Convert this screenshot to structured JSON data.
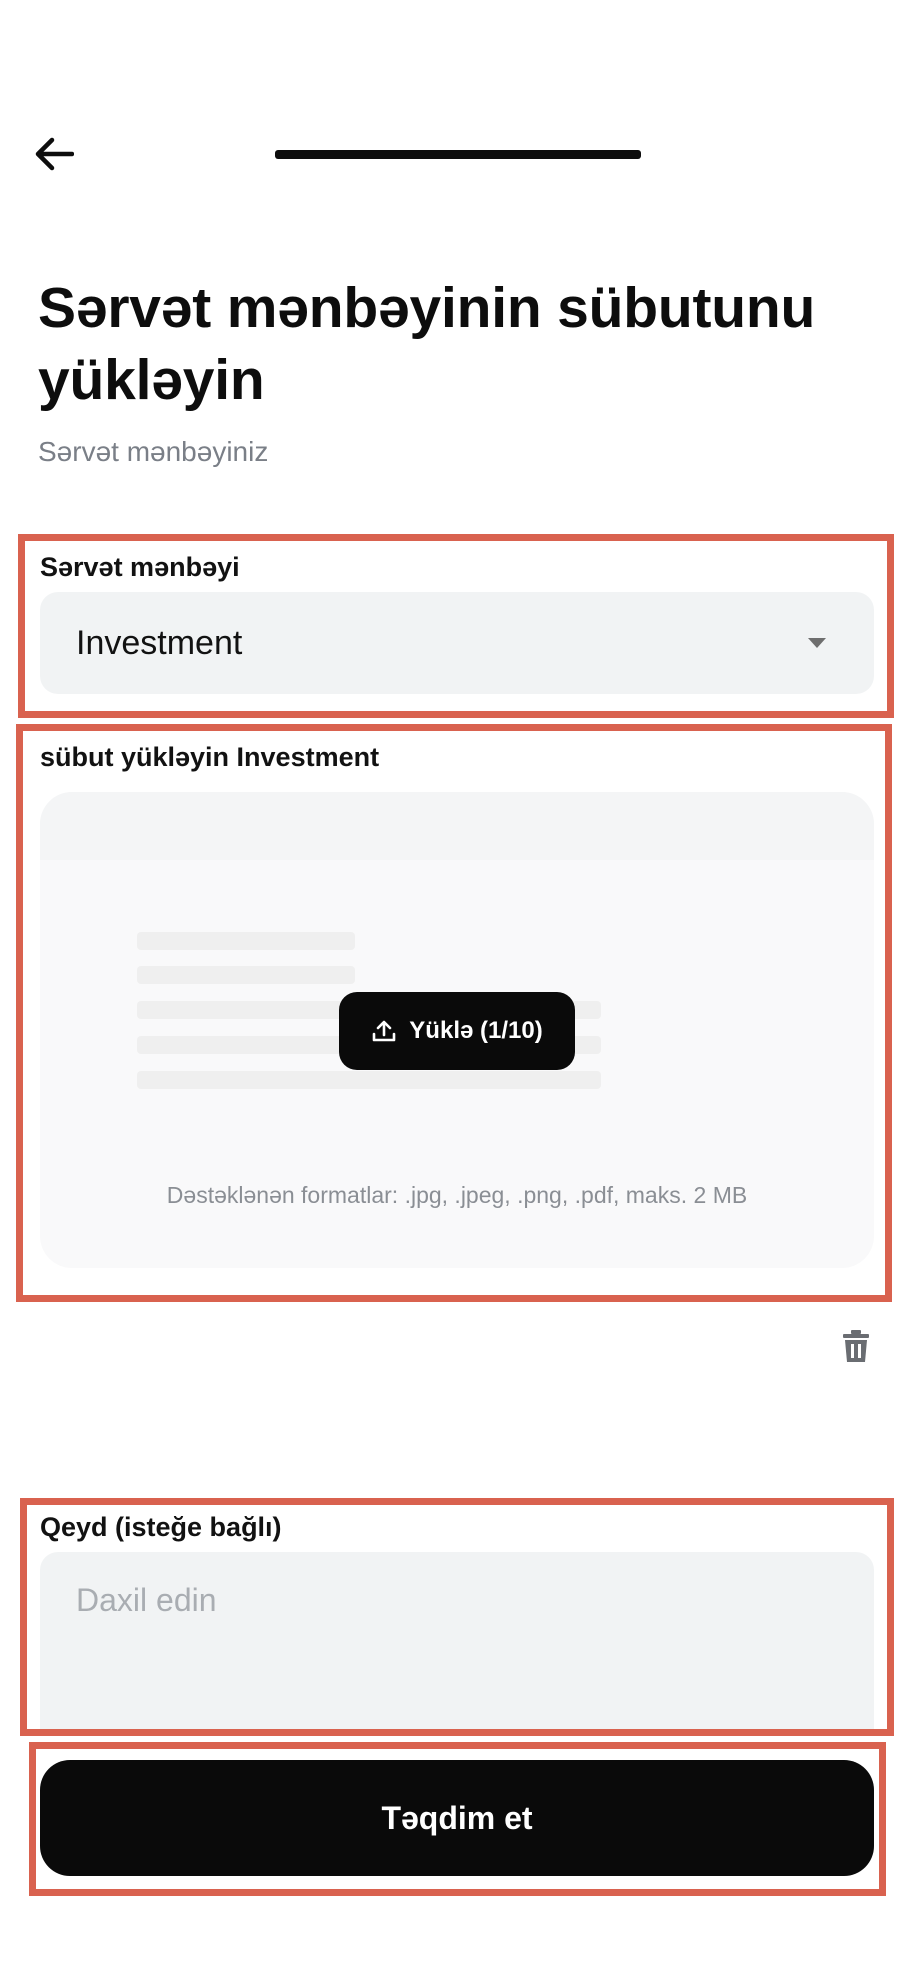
{
  "header": {
    "back_icon": "arrow-left-icon",
    "progress_fraction": 1.0
  },
  "page": {
    "title": "Sərvət mənbəyinin sübutunu yükləyin",
    "subtitle": "Sərvət mənbəyiniz"
  },
  "wealth_source": {
    "label": "Sərvət mənbəyi",
    "selected": "Investment",
    "icon": "caret-down-icon"
  },
  "upload": {
    "label": "sübut yükləyin Investment",
    "button_label": "Yüklə (1/10)",
    "button_icon": "upload-icon",
    "formats": "Dəstəklənən formatlar: .jpg, .jpeg, .png, .pdf, maks. 2 MB",
    "delete_icon": "trash-icon"
  },
  "note": {
    "label": "Qeyd (isteğe bağlı)",
    "placeholder": "Daxil edin"
  },
  "submit": {
    "label": "Təqdim et"
  },
  "colors": {
    "primary": "#0a0a0a",
    "field_bg": "#f1f3f4",
    "highlight": "#d9624f"
  }
}
